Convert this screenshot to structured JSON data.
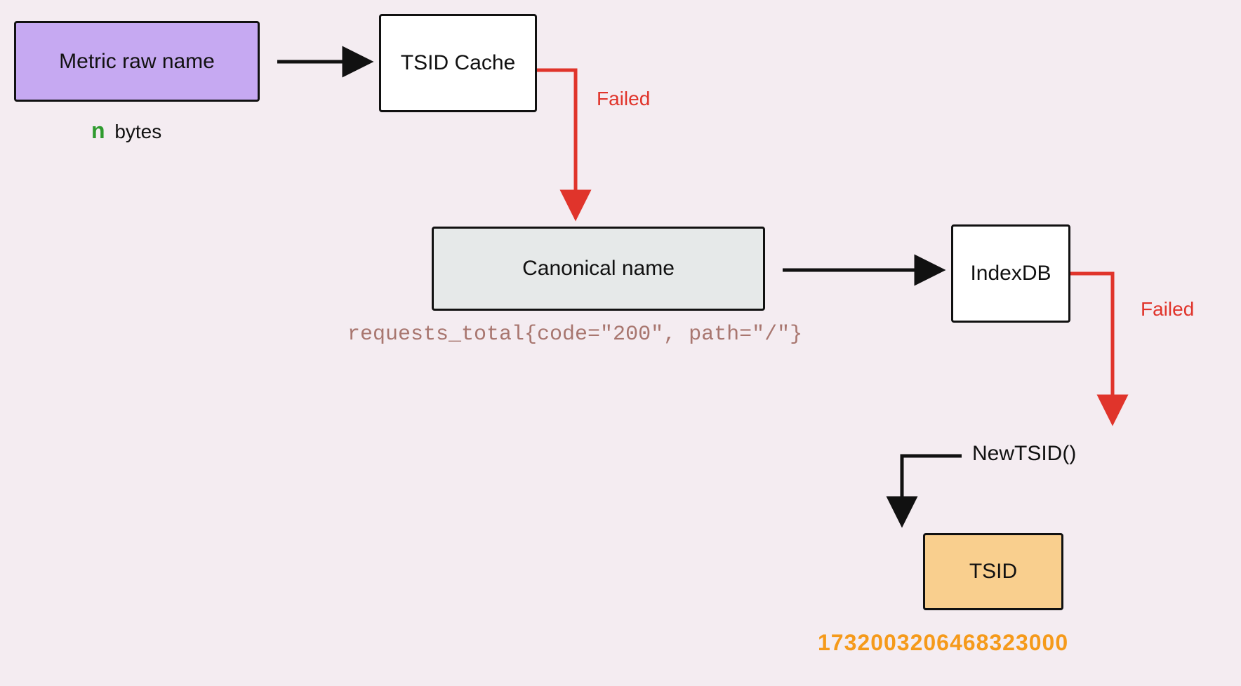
{
  "nodes": {
    "metric_raw": {
      "label": "Metric raw name"
    },
    "tsid_cache": {
      "label": "TSID Cache"
    },
    "canonical": {
      "label": "Canonical name"
    },
    "indexdb": {
      "label": "IndexDB"
    },
    "tsid": {
      "label": "TSID"
    }
  },
  "annotations": {
    "n_letter": "n",
    "bytes": "bytes",
    "failed1": "Failed",
    "failed2": "Failed",
    "canonical_example": "requests_total{code=\"200\", path=\"/\"}",
    "new_tsid_fn": "NewTSID()",
    "tsid_value": "1732003206468323000"
  },
  "colors": {
    "bg": "#f4ecf1",
    "purple": "#c6a9f2",
    "gray": "#e6e9e9",
    "orange_box": "#f9cf8e",
    "red": "#e0342b",
    "brown": "#a8766f",
    "green": "#2f9b2f",
    "orange_text": "#f59a1b",
    "black": "#111111"
  },
  "diagram_flow": [
    {
      "from": "metric_raw",
      "to": "tsid_cache",
      "color": "black"
    },
    {
      "from": "tsid_cache",
      "to": "canonical",
      "color": "red",
      "label": "Failed"
    },
    {
      "from": "canonical",
      "to": "indexdb",
      "color": "black"
    },
    {
      "from": "indexdb",
      "to": "new_tsid_fn_turn",
      "color": "red",
      "label": "Failed"
    },
    {
      "from": "new_tsid_fn_turn",
      "to": "tsid",
      "color": "black",
      "label": "NewTSID()"
    }
  ]
}
